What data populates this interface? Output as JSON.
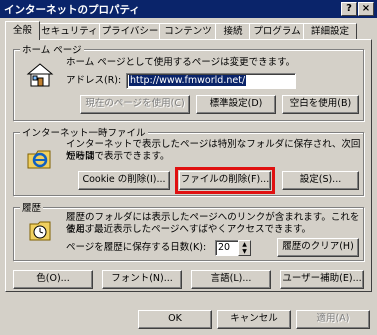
{
  "window": {
    "title": "インターネットのプロパティ",
    "help_button": "?",
    "close_button": "×"
  },
  "tabs": [
    "全般",
    "セキュリティ",
    "プライバシー",
    "コンテンツ",
    "接続",
    "プログラム",
    "詳細設定"
  ],
  "homepage": {
    "group_label": "ホーム ページ",
    "description": "ホーム ページとして使用するページは変更できます。",
    "address_label": "アドレス(R):",
    "address_value": "http://www.fmworld.net/",
    "use_current": "現在のページを使用(C)",
    "use_default": "標準設定(D)",
    "use_blank": "空白を使用(B)"
  },
  "temp_files": {
    "group_label": "インターネット一時ファイル",
    "description_1": "インターネットで表示したページは特別なフォルダに保存され、次回からは",
    "description_2": "短時間で表示できます。",
    "delete_cookies": "Cookie の削除(I)...",
    "delete_files": "ファイルの削除(F)...",
    "settings": "設定(S)..."
  },
  "history": {
    "group_label": "履歴",
    "description_1": "履歴のフォルダには表示したページへのリンクが含まれます。これを使用す",
    "description_2": "ると、最近表示したページへすばやくアクセスできます。",
    "days_label": "ページを履歴に保存する日数(K):",
    "days_value": "20",
    "clear_history": "履歴のクリア(H)"
  },
  "bottom_buttons": {
    "colors": "色(O)...",
    "fonts": "フォント(N)...",
    "languages": "言語(L)...",
    "accessibility": "ユーザー補助(E)..."
  },
  "dialog_buttons": {
    "ok": "OK",
    "cancel": "キャンセル",
    "apply": "適用(A)"
  },
  "highlight_color": "#e01010"
}
